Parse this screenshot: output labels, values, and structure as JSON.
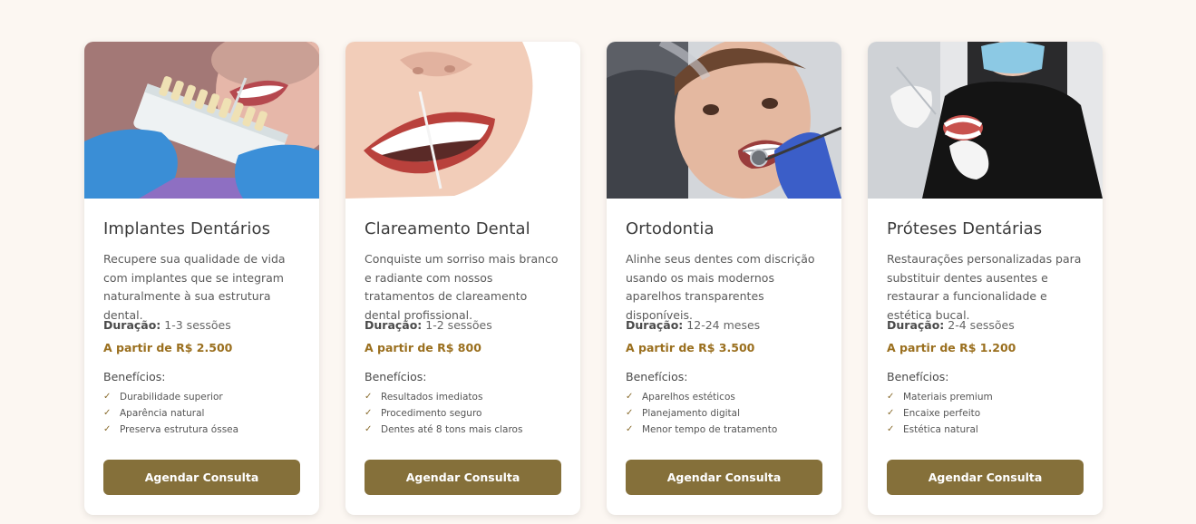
{
  "cards": [
    {
      "title": "Implantes Dentários",
      "description": "Recupere sua qualidade de vida com implantes que se integram naturalmente à sua estrutura dental.",
      "duration_label": "Duração:",
      "duration_value": "1-3 sessões",
      "price": "A partir de R$ 2.500",
      "benefits_title": "Benefícios:",
      "benefits": [
        "Durabilidade superior",
        "Aparência natural",
        "Preserva estrutura óssea"
      ],
      "button": "Agendar Consulta"
    },
    {
      "title": "Clareamento Dental",
      "description": "Conquiste um sorriso mais branco e radiante com nossos tratamentos de clareamento dental profissional.",
      "duration_label": "Duração:",
      "duration_value": "1-2 sessões",
      "price": "A partir de R$ 800",
      "benefits_title": "Benefícios:",
      "benefits": [
        "Resultados imediatos",
        "Procedimento seguro",
        "Dentes até 8 tons mais claros"
      ],
      "button": "Agendar Consulta"
    },
    {
      "title": "Ortodontia",
      "description": "Alinhe seus dentes com discrição usando os mais modernos aparelhos transparentes disponíveis.",
      "duration_label": "Duração:",
      "duration_value": "12-24 meses",
      "price": "A partir de R$ 3.500",
      "benefits_title": "Benefícios:",
      "benefits": [
        "Aparelhos estéticos",
        "Planejamento digital",
        "Menor tempo de tratamento"
      ],
      "button": "Agendar Consulta"
    },
    {
      "title": "Próteses Dentárias",
      "description": "Restaurações personalizadas para substituir dentes ausentes e restaurar a funcionalidade e estética bucal.",
      "duration_label": "Duração:",
      "duration_value": "2-4 sessões",
      "price": "A partir de R$ 1.200",
      "benefits_title": "Benefícios:",
      "benefits": [
        "Materiais premium",
        "Encaixe perfeito",
        "Estética natural"
      ],
      "button": "Agendar Consulta"
    }
  ],
  "icons": {
    "benefit": "check-icon"
  },
  "colors": {
    "background": "#fcf7f2",
    "accent": "#85703a",
    "price": "#9a6f1e"
  }
}
